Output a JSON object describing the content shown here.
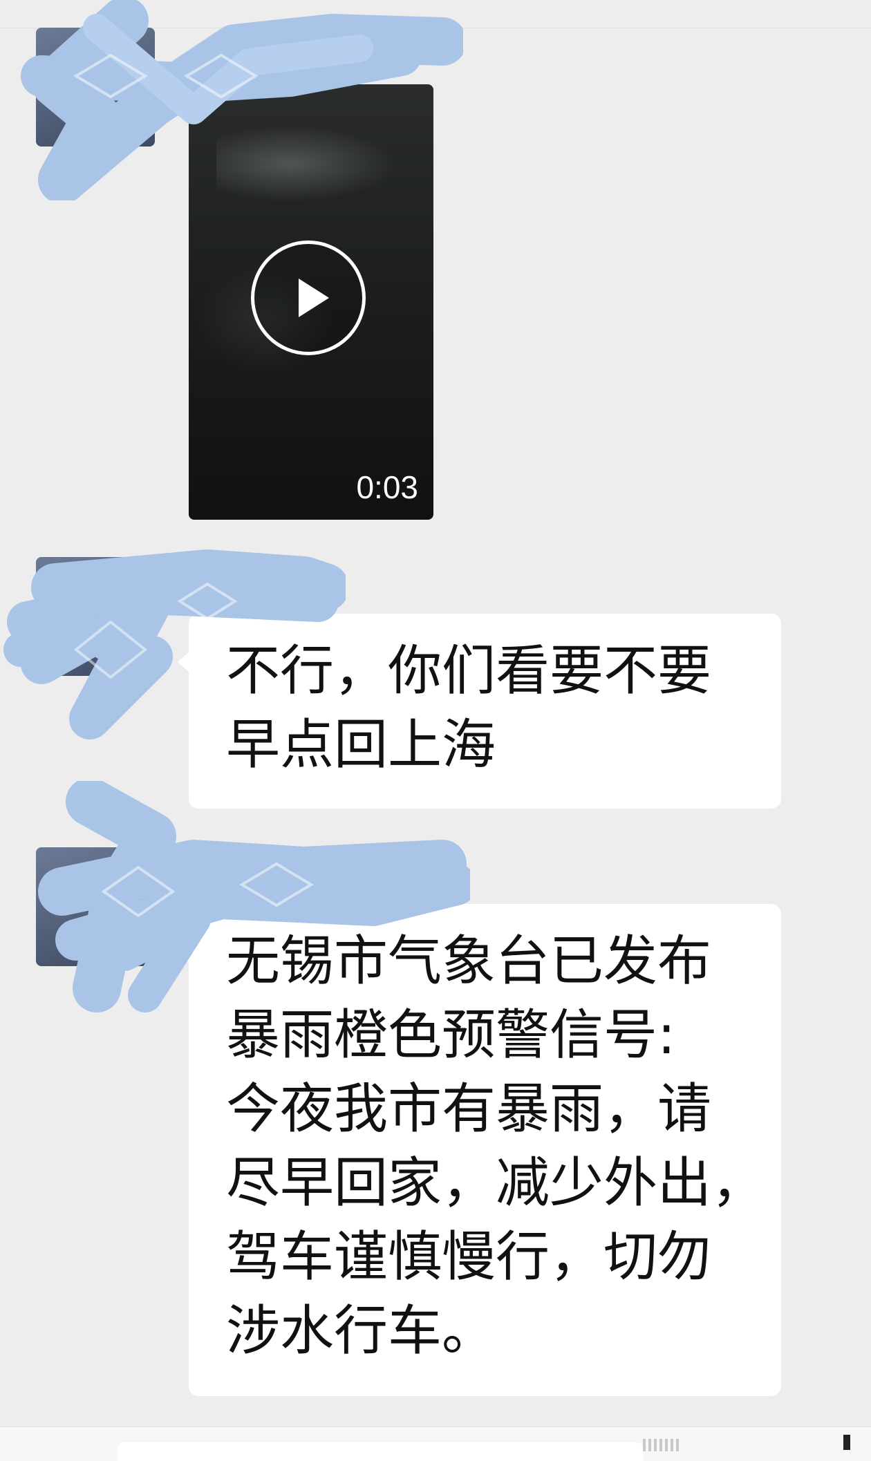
{
  "video_message": {
    "duration": "0:03"
  },
  "messages": [
    {
      "lines": [
        "不行，你们看要不要",
        "早点回上海"
      ]
    },
    {
      "lines": [
        "无锡市气象台已发布",
        "暴雨橙色预警信号:",
        "今夜我市有暴雨，请",
        "尽早回家，减少外出，",
        "驾车谨慎慢行，切勿",
        "涉水行车。"
      ]
    }
  ],
  "colors": {
    "chat_background": "#ededed",
    "bubble": "#ffffff",
    "redaction_scribble": "#a9c4e6"
  },
  "icons": {
    "play": "play-icon"
  }
}
